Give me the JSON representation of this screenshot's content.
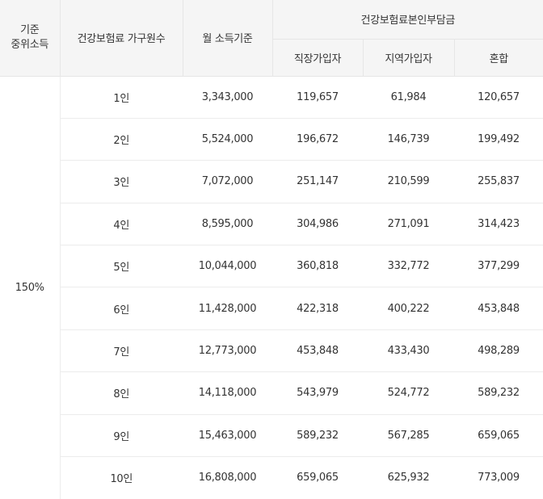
{
  "table": {
    "headers": {
      "median_income_line1": "기준",
      "median_income_line2": "중위소득",
      "household_size": "건강보험료 가구원수",
      "monthly_income": "월 소득기준",
      "premium_group": "건강보험료본인부담금",
      "employee": "직장가입자",
      "regional": "지역가입자",
      "mixed": "혼합"
    },
    "group_label": "150%",
    "rows": [
      {
        "household": "1인",
        "income": "3,343,000",
        "employee": "119,657",
        "regional": "61,984",
        "mixed": "120,657"
      },
      {
        "household": "2인",
        "income": "5,524,000",
        "employee": "196,672",
        "regional": "146,739",
        "mixed": "199,492"
      },
      {
        "household": "3인",
        "income": "7,072,000",
        "employee": "251,147",
        "regional": "210,599",
        "mixed": "255,837"
      },
      {
        "household": "4인",
        "income": "8,595,000",
        "employee": "304,986",
        "regional": "271,091",
        "mixed": "314,423"
      },
      {
        "household": "5인",
        "income": "10,044,000",
        "employee": "360,818",
        "regional": "332,772",
        "mixed": "377,299"
      },
      {
        "household": "6인",
        "income": "11,428,000",
        "employee": "422,318",
        "regional": "400,222",
        "mixed": "453,848"
      },
      {
        "household": "7인",
        "income": "12,773,000",
        "employee": "453,848",
        "regional": "433,430",
        "mixed": "498,289"
      },
      {
        "household": "8인",
        "income": "14,118,000",
        "employee": "543,979",
        "regional": "524,772",
        "mixed": "589,232"
      },
      {
        "household": "9인",
        "income": "15,463,000",
        "employee": "589,232",
        "regional": "567,285",
        "mixed": "659,065"
      },
      {
        "household": "10인",
        "income": "16,808,000",
        "employee": "659,065",
        "regional": "625,932",
        "mixed": "773,009"
      }
    ]
  }
}
